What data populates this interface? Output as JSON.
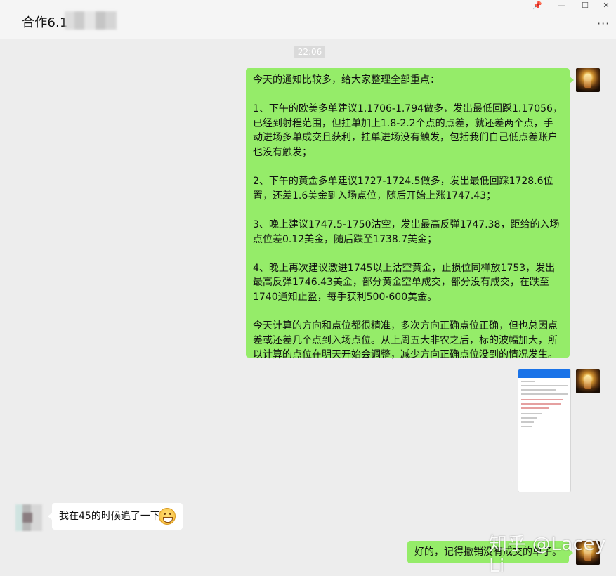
{
  "header": {
    "chat_title": "合作6.1",
    "more_icon": "more-horizontal-icon",
    "window_controls": {
      "pin": "📌",
      "minimize": "—",
      "maximize": "☐",
      "close": "✕"
    }
  },
  "messages": {
    "timestamp": "22:06",
    "outgoing_long": {
      "paragraphs": [
        "今天的通知比较多，给大家整理全部重点：",
        "1、下午的欧美多单建议1.1706-1.794做多，发出最低回踩1.17056，已经到射程范围，但挂单加上1.8-2.2个点的点差，就还差两个点，手动进场多单成交且获利，挂单进场没有触发，包括我们自己低点差账户也没有触发；",
        "2、下午的黄金多单建议1727-1724.5做多，发出最低回踩1728.6位置，还差1.6美金到入场点位，随后开始上涨1747.43；",
        "3、晚上建议1747.5-1750沽空，发出最高反弹1747.38，距给的入场点位差0.12美金，随后跌至1738.7美金；",
        "4、晚上再次建议激进1745以上沽空黄金，止损位同样放1753，发出最高反弹1746.43美金，部分黄金空单成交，部分没有成交，在跌至1740通知止盈，每手获利500-600美金。",
        "今天计算的方向和点位都很精准，多次方向正确点位正确，但也总因点差或还差几个点到入场点位。从上周五大非农之后，标的波幅加大，所以计算的点位在明天开始会调整，减少方向正确点位没到的情况发生。"
      ]
    },
    "incoming": {
      "text": "我在45的时候追了一下",
      "emoji": "grinning-face-icon"
    },
    "outgoing_short": {
      "text": "好的，记得撤销没有成交的单子。"
    }
  },
  "watermark": "知乎 @Lacey Li"
}
